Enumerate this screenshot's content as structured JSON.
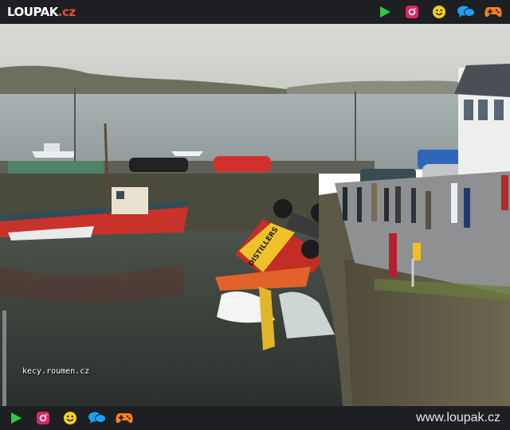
{
  "header": {
    "logo_text": "LOUPAK",
    "logo_tld": ".cz"
  },
  "top_icons": [
    {
      "name": "play-icon",
      "color": "#2ecc40"
    },
    {
      "name": "instagram-icon",
      "color": "#e0245e"
    },
    {
      "name": "smiley-icon",
      "color": "#f5d020"
    },
    {
      "name": "chat-icon",
      "color": "#1da1f2"
    },
    {
      "name": "gamepad-icon",
      "color": "#ff7f1a"
    }
  ],
  "photo": {
    "watermark": "kecy.roumen.cz",
    "truck_door_text": "DISTILLERS"
  },
  "footer": {
    "site_url": "www.loupak.cz"
  }
}
